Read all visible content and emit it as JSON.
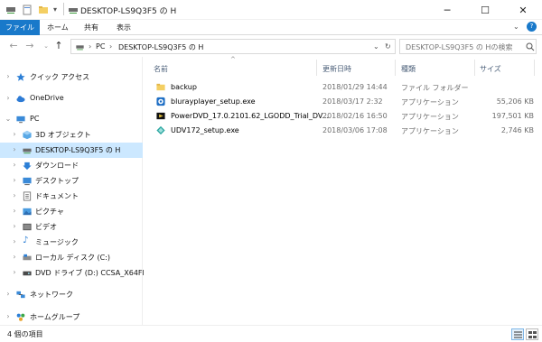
{
  "window": {
    "title": "DESKTOP-LS9Q3F5 の H",
    "minimize": "─",
    "maximize": "☐",
    "close": "✕"
  },
  "ribbon": {
    "tabs": [
      "ファイル",
      "ホーム",
      "共有",
      "表示"
    ]
  },
  "address": {
    "crumbs": [
      "PC",
      "DESKTOP-LS9Q3F5 の H"
    ],
    "search_placeholder": "DESKTOP-LS9Q3F5 の Hの検索"
  },
  "nav_pane": {
    "items": [
      {
        "label": "クイック アクセス",
        "icon": "star-icon"
      },
      {
        "label": "OneDrive",
        "icon": "cloud-icon"
      },
      {
        "label": "PC",
        "icon": "computer-icon"
      },
      {
        "label": "3D オブジェクト",
        "icon": "cube-icon"
      },
      {
        "label": "DESKTOP-LS9Q3F5 の H",
        "icon": "network-drive-icon"
      },
      {
        "label": "ダウンロード",
        "icon": "download-icon"
      },
      {
        "label": "デスクトップ",
        "icon": "desktop-icon"
      },
      {
        "label": "ドキュメント",
        "icon": "document-icon"
      },
      {
        "label": "ピクチャ",
        "icon": "picture-icon"
      },
      {
        "label": "ビデオ",
        "icon": "video-icon"
      },
      {
        "label": "ミュージック",
        "icon": "music-icon"
      },
      {
        "label": "ローカル ディスク (C:)",
        "icon": "disk-icon"
      },
      {
        "label": "DVD ドライブ (D:) CCSA_X64FRE_",
        "icon": "dvd-icon"
      },
      {
        "label": "ネットワーク",
        "icon": "network-icon"
      },
      {
        "label": "ホームグループ",
        "icon": "homegroup-icon"
      }
    ]
  },
  "columns": {
    "name": "名前",
    "date": "更新日時",
    "type": "種類",
    "size": "サイズ"
  },
  "files": [
    {
      "name": "backup",
      "date": "2018/01/29 14:44",
      "type": "ファイル フォルダー",
      "size": "",
      "icon": "folder-icon"
    },
    {
      "name": "blurayplayer_setup.exe",
      "date": "2018/03/17 2:32",
      "type": "アプリケーション",
      "size": "55,206 KB",
      "icon": "exe-icon"
    },
    {
      "name": "PowerDVD_17.0.2101.62_LGODD_Trial_DV...",
      "date": "2018/02/16 16:50",
      "type": "アプリケーション",
      "size": "197,501 KB",
      "icon": "powerdvd-icon"
    },
    {
      "name": "UDV172_setup.exe",
      "date": "2018/03/06 17:08",
      "type": "アプリケーション",
      "size": "2,746 KB",
      "icon": "setup-icon"
    }
  ],
  "status": {
    "item_count": "4 個の項目"
  },
  "colors": {
    "accent": "#1979ca",
    "selection": "#cce8ff"
  }
}
